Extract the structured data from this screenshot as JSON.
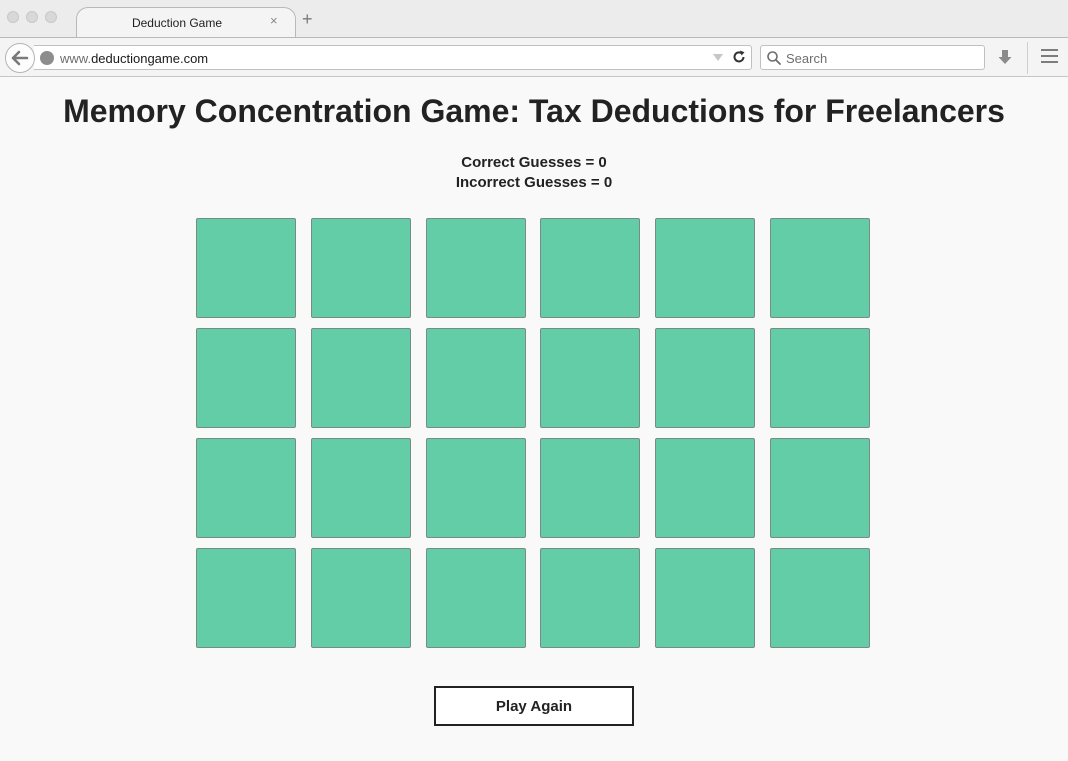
{
  "browser": {
    "tab_title": "Deduction Game",
    "tab_close": "×",
    "new_tab": "+",
    "url_prefix": "www.",
    "url_domain": "deductiongame.com",
    "search_placeholder": "Search",
    "icons": [
      "back-arrow-icon",
      "globe-icon",
      "dropdown-icon",
      "reload-icon",
      "search-icon",
      "download-icon",
      "menu-icon"
    ]
  },
  "page": {
    "title": "Memory Concentration Game: Tax Deductions for Freelancers",
    "correct_label": "Correct Guesses = 0",
    "incorrect_label": "Incorrect Guesses = 0",
    "correct_count": 0,
    "incorrect_count": 0,
    "play_again_label": "Play Again"
  },
  "board": {
    "rows": 4,
    "columns": 6,
    "face_down_color": "#62cda6"
  }
}
